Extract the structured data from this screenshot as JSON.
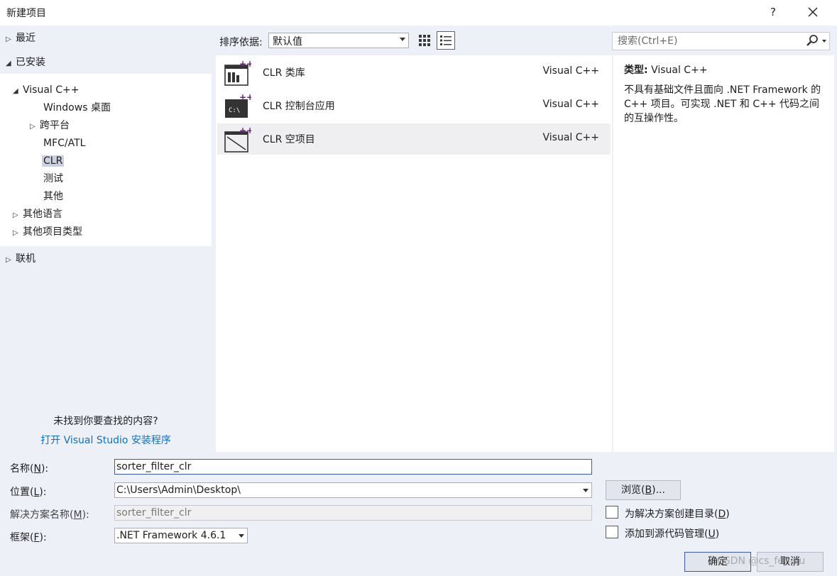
{
  "dialog": {
    "title": "新建项目",
    "help": "?",
    "close": "✕"
  },
  "nav": {
    "recent": "最近",
    "installed": "已安装",
    "visual_cpp": "Visual C++",
    "windows_desktop": "Windows 桌面",
    "cross_platform": "跨平台",
    "mfc_atl": "MFC/ATL",
    "clr": "CLR",
    "test": "测试",
    "other": "其他",
    "other_languages": "其他语言",
    "other_project_types": "其他项目类型",
    "online": "联机",
    "not_found": "未找到你要查找的内容?",
    "open_installer": "打开 Visual Studio 安装程序"
  },
  "toolbar": {
    "sort_label": "排序依据:",
    "sort_value": "默认值",
    "search_placeholder": "搜索(Ctrl+E)"
  },
  "templates": [
    {
      "name": "CLR 类库",
      "lang": "Visual C++",
      "icon": "class-library-icon"
    },
    {
      "name": "CLR 控制台应用",
      "lang": "Visual C++",
      "icon": "console-app-icon"
    },
    {
      "name": "CLR 空项目",
      "lang": "Visual C++",
      "icon": "empty-project-icon"
    }
  ],
  "selected_template_index": 2,
  "description": {
    "type_label": "类型:",
    "type_value": "Visual C++",
    "text": "不具有基础文件且面向 .NET Framework 的 C++ 项目。可实现 .NET 和 C++ 代码之间的互操作性。"
  },
  "form": {
    "name_label_prefix": "名称(",
    "name_label_key": "N",
    "name_label_suffix": "):",
    "name_value": "sorter_filter_clr",
    "location_label_prefix": "位置(",
    "location_label_key": "L",
    "location_label_suffix": "):",
    "location_value": "C:\\Users\\Admin\\Desktop\\",
    "solution_label_prefix": "解决方案名称(",
    "solution_label_key": "M",
    "solution_label_suffix": "):",
    "solution_value": "sorter_filter_clr",
    "framework_label_prefix": "框架(",
    "framework_label_key": "F",
    "framework_label_suffix": "):",
    "framework_value": ".NET Framework 4.6.1",
    "browse_prefix": "浏览(",
    "browse_key": "B",
    "browse_suffix": ")...",
    "create_dir_prefix": "为解决方案创建目录(",
    "create_dir_key": "D",
    "create_dir_suffix": ")",
    "source_control_prefix": "添加到源代码管理(",
    "source_control_key": "U",
    "source_control_suffix": ")",
    "ok": "确定",
    "cancel": "取消",
    "watermark": "CSDN @cs_fenglu"
  },
  "colors": {
    "accent_link": "#0e70c0",
    "selection": "#cbd1e1",
    "clr_purple": "#68217a"
  }
}
